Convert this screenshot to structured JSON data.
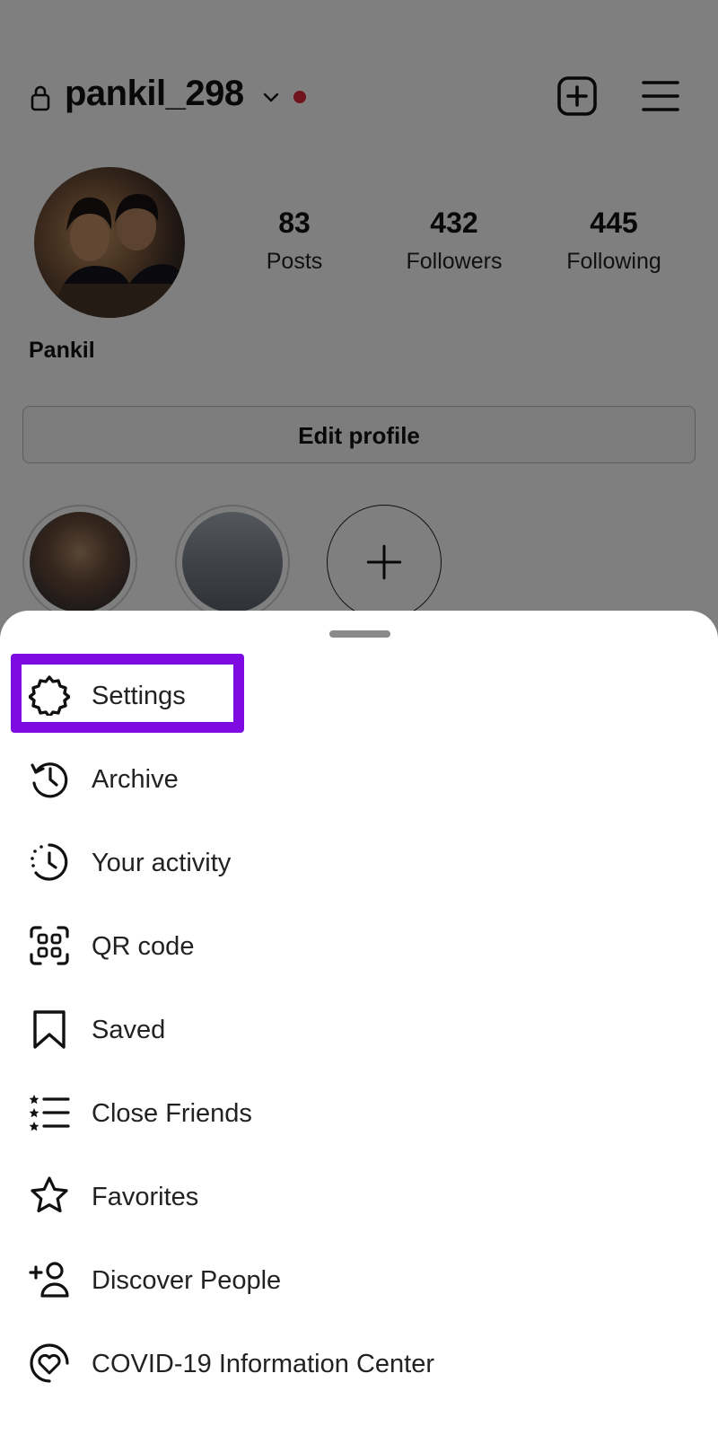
{
  "profile": {
    "username": "pankil_298",
    "display_name": "Pankil",
    "stats": [
      {
        "value": "83",
        "label": "Posts"
      },
      {
        "value": "432",
        "label": "Followers"
      },
      {
        "value": "445",
        "label": "Following"
      }
    ],
    "edit_profile_label": "Edit profile",
    "notification_dot_color": "#e0263b"
  },
  "highlights": [
    {
      "name": "highlight-1"
    },
    {
      "name": "highlight-2"
    },
    {
      "name": "new-highlight"
    }
  ],
  "sheet": {
    "items": [
      {
        "label": "Settings",
        "icon": "gear-icon"
      },
      {
        "label": "Archive",
        "icon": "history-clock-icon"
      },
      {
        "label": "Your activity",
        "icon": "activity-clock-icon"
      },
      {
        "label": "QR code",
        "icon": "qr-code-icon"
      },
      {
        "label": "Saved",
        "icon": "bookmark-icon"
      },
      {
        "label": "Close Friends",
        "icon": "star-list-icon"
      },
      {
        "label": "Favorites",
        "icon": "star-icon"
      },
      {
        "label": "Discover People",
        "icon": "add-person-icon"
      },
      {
        "label": "COVID-19 Information Center",
        "icon": "heart-circle-icon"
      }
    ],
    "highlight_color": "#7d0be0"
  }
}
